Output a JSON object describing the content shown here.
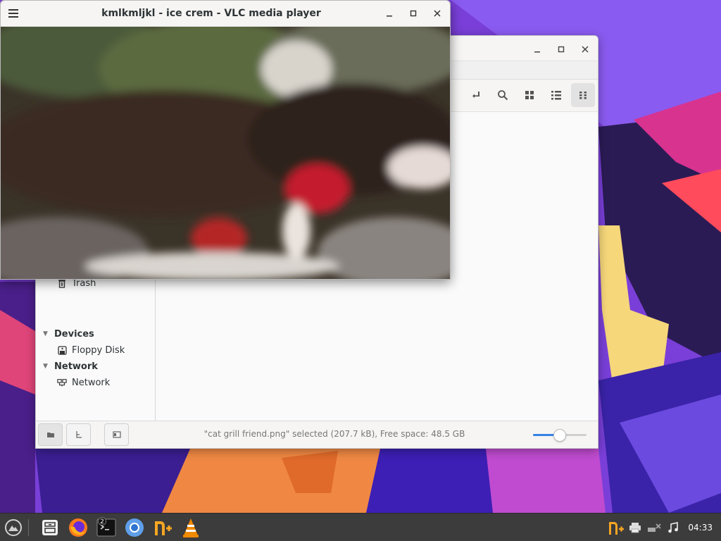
{
  "vlc": {
    "title": "kmlkmljkl - ice crem - VLC media player",
    "minimize_icon": "minimize-icon",
    "maximize_icon": "maximize-icon",
    "close_icon": "close-icon",
    "menu_icon": "hamburger-menu-icon"
  },
  "file_manager": {
    "toolbar": [
      "open-location-icon",
      "search-icon",
      "icon-view-icon",
      "list-view-icon",
      "compact-view-icon"
    ],
    "sidebar": {
      "places_partial_item": "Trash",
      "sections": [
        {
          "header": "Devices",
          "items": [
            {
              "label": "Floppy Disk",
              "icon": "floppy-disk-icon"
            }
          ]
        },
        {
          "header": "Network",
          "items": [
            {
              "label": "Network",
              "icon": "network-icon"
            }
          ]
        }
      ]
    },
    "status": {
      "text": "\"cat grill friend.png\" selected (207.7 kB), Free space: 48.5 GB",
      "zoom_fraction": 0.5
    }
  },
  "taskbar": {
    "apps": [
      "app-menu-icon",
      "file-manager-icon",
      "firefox-icon",
      "terminal-icon",
      "chromium-icon",
      "notes-app-icon",
      "vlc-icon"
    ],
    "terminal_badge": "2",
    "tray": [
      "update-notifier-icon",
      "printer-icon",
      "network-disconnected-icon",
      "media-icon"
    ],
    "clock": "04:33"
  },
  "colors": {
    "accent": "#3584e4",
    "taskbar": "#3c3c3c",
    "vlc_orange": "#f08a00"
  }
}
